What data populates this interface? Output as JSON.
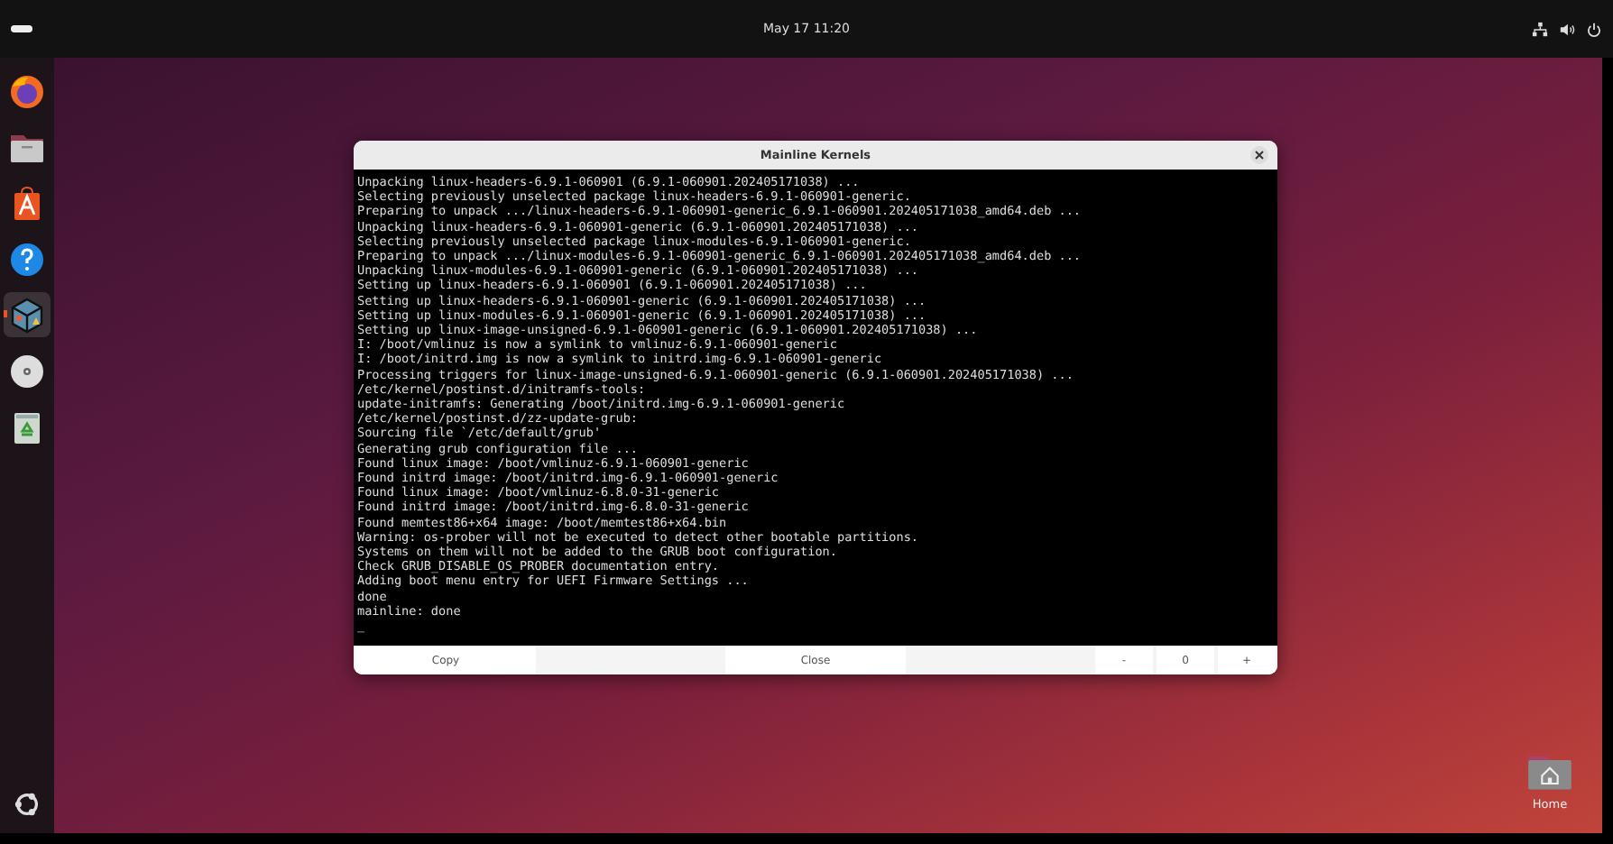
{
  "top_bar": {
    "clock": "May 17  11:20"
  },
  "dock": {
    "items": [
      {
        "kind": "browser",
        "running": false
      },
      {
        "kind": "files",
        "running": false
      },
      {
        "kind": "store",
        "running": false
      },
      {
        "kind": "help",
        "running": false
      },
      {
        "kind": "cube",
        "running": true
      },
      {
        "kind": "disc",
        "running": false
      },
      {
        "kind": "trash",
        "running": false
      }
    ]
  },
  "window": {
    "title": "Mainline Kernels",
    "terminal_lines": [
      "Unpacking linux-headers-6.9.1-060901 (6.9.1-060901.202405171038) ...",
      "Selecting previously unselected package linux-headers-6.9.1-060901-generic.",
      "Preparing to unpack .../linux-headers-6.9.1-060901-generic_6.9.1-060901.202405171038_amd64.deb ...",
      "Unpacking linux-headers-6.9.1-060901-generic (6.9.1-060901.202405171038) ...",
      "Selecting previously unselected package linux-modules-6.9.1-060901-generic.",
      "Preparing to unpack .../linux-modules-6.9.1-060901-generic_6.9.1-060901.202405171038_amd64.deb ...",
      "Unpacking linux-modules-6.9.1-060901-generic (6.9.1-060901.202405171038) ...",
      "Setting up linux-headers-6.9.1-060901 (6.9.1-060901.202405171038) ...",
      "Setting up linux-headers-6.9.1-060901-generic (6.9.1-060901.202405171038) ...",
      "Setting up linux-modules-6.9.1-060901-generic (6.9.1-060901.202405171038) ...",
      "Setting up linux-image-unsigned-6.9.1-060901-generic (6.9.1-060901.202405171038) ...",
      "I: /boot/vmlinuz is now a symlink to vmlinuz-6.9.1-060901-generic",
      "I: /boot/initrd.img is now a symlink to initrd.img-6.9.1-060901-generic",
      "Processing triggers for linux-image-unsigned-6.9.1-060901-generic (6.9.1-060901.202405171038) ...",
      "/etc/kernel/postinst.d/initramfs-tools:",
      "update-initramfs: Generating /boot/initrd.img-6.9.1-060901-generic",
      "/etc/kernel/postinst.d/zz-update-grub:",
      "Sourcing file `/etc/default/grub'",
      "Generating grub configuration file ...",
      "Found linux image: /boot/vmlinuz-6.9.1-060901-generic",
      "Found initrd image: /boot/initrd.img-6.9.1-060901-generic",
      "Found linux image: /boot/vmlinuz-6.8.0-31-generic",
      "Found initrd image: /boot/initrd.img-6.8.0-31-generic",
      "Found memtest86+x64 image: /boot/memtest86+x64.bin",
      "Warning: os-prober will not be executed to detect other bootable partitions.",
      "Systems on them will not be added to the GRUB boot configuration.",
      "Check GRUB_DISABLE_OS_PROBER documentation entry.",
      "Adding boot menu entry for UEFI Firmware Settings ...",
      "done",
      "mainline: done",
      "_"
    ],
    "buttons": {
      "copy": "Copy",
      "close": "Close",
      "minus": "-",
      "value": "0",
      "plus": "+"
    }
  },
  "desktop_icons": [
    {
      "label": "Home"
    }
  ]
}
